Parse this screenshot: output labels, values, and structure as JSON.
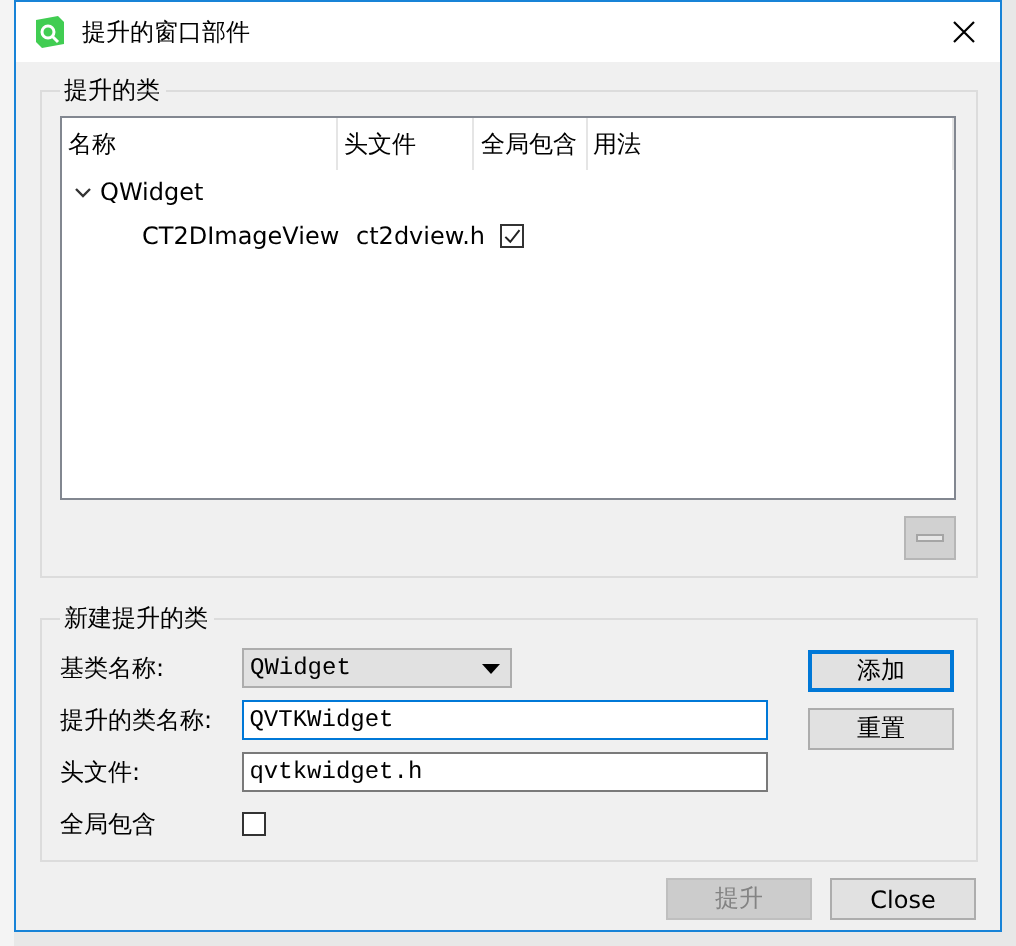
{
  "window": {
    "title": "提升的窗口部件"
  },
  "promoted_classes": {
    "title": "提升的类",
    "columns": [
      "名称",
      "头文件",
      "全局包含",
      "用法"
    ],
    "tree": [
      {
        "name": "QWidget",
        "expanded": true,
        "children": [
          {
            "name": "CT2DImageView",
            "header_file": "ct2dview.h",
            "global_include": true
          }
        ]
      }
    ],
    "remove_button": {
      "disabled": true
    }
  },
  "new_promoted_class": {
    "title": "新建提升的类",
    "fields": [
      {
        "kind": "combo",
        "label": "基类名称:",
        "value": "QWidget"
      },
      {
        "kind": "text",
        "label": "提升的类名称:",
        "value": "QVTKWidget"
      },
      {
        "kind": "text",
        "label": "头文件:",
        "value": "qvtkwidget.h"
      },
      {
        "kind": "checkbox",
        "label": "全局包含",
        "checked": false
      }
    ],
    "buttons": [
      {
        "label": "添加",
        "default": true
      },
      {
        "label": "重置",
        "default": false
      }
    ]
  },
  "footer_buttons": [
    {
      "label": "提升",
      "disabled": true
    },
    {
      "label": "Close",
      "disabled": false
    }
  ]
}
